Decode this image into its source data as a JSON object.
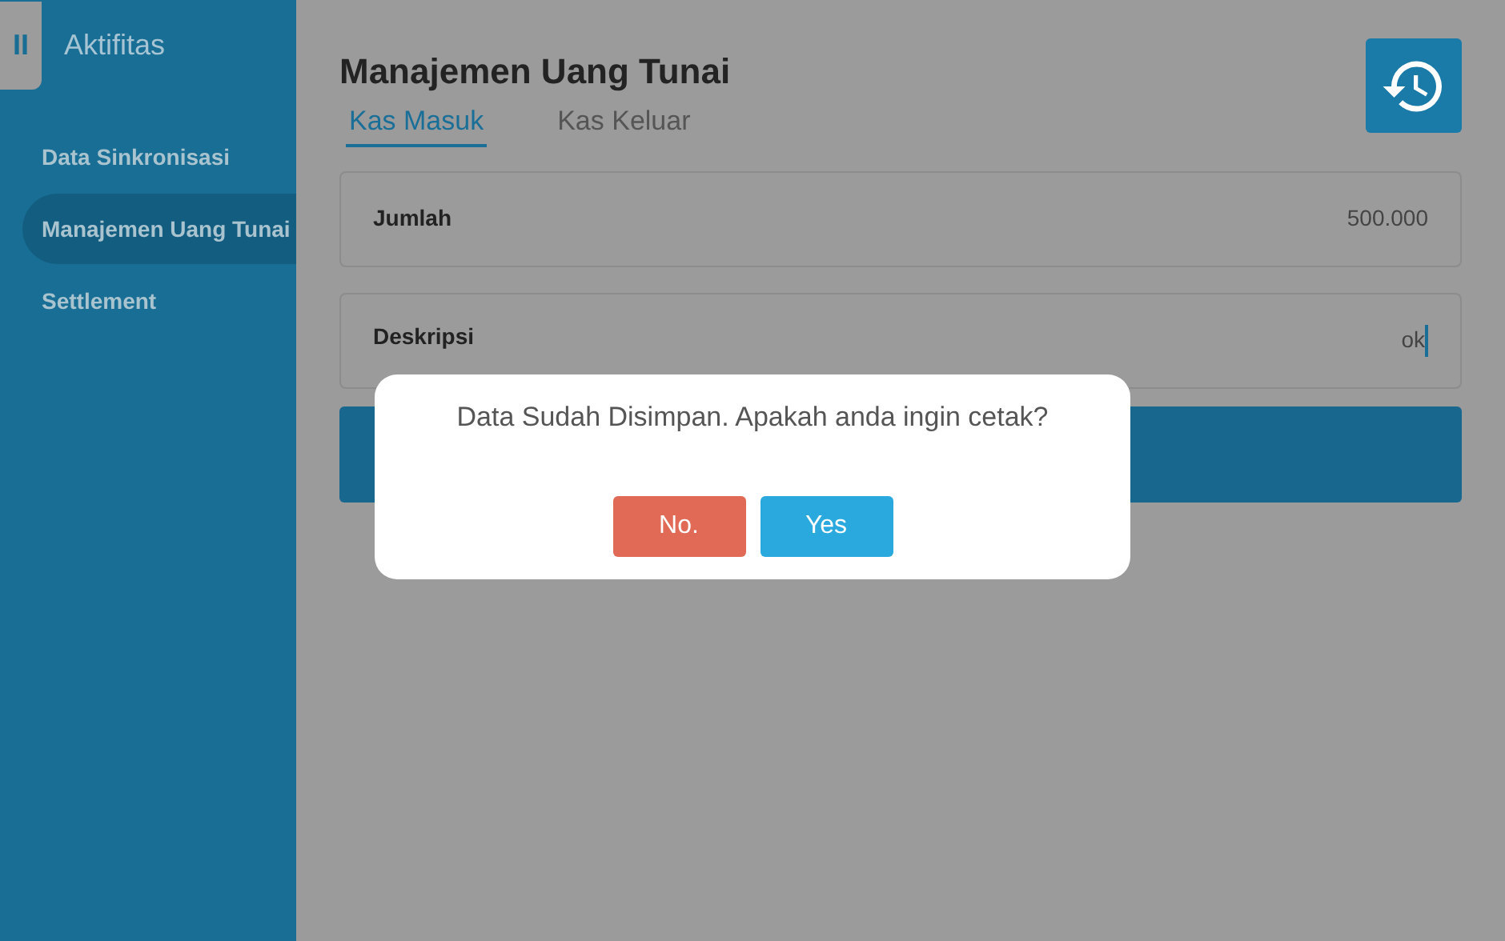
{
  "sidebar": {
    "toggle": "II",
    "title": "Aktifitas",
    "items": [
      {
        "label": "Data Sinkronisasi",
        "selected": false
      },
      {
        "label": "Manajemen Uang Tunai",
        "selected": true
      },
      {
        "label": "Settlement",
        "selected": false
      }
    ]
  },
  "page_title": "Manajemen Uang Tunai",
  "tabs": [
    {
      "label": "Kas Masuk",
      "selected": true
    },
    {
      "label": "Kas Keluar",
      "selected": false
    }
  ],
  "fields": [
    {
      "label": "Jumlah",
      "value": "500.000",
      "focused": false
    },
    {
      "label": "Deskripsi",
      "value": "ok",
      "focused": true
    }
  ],
  "dialog": {
    "message": "Data Sudah Disimpan. Apakah anda ingin cetak?",
    "buttons": [
      {
        "label": "No.",
        "kind": "cancel"
      },
      {
        "label": "Yes",
        "kind": "confirm"
      }
    ]
  }
}
